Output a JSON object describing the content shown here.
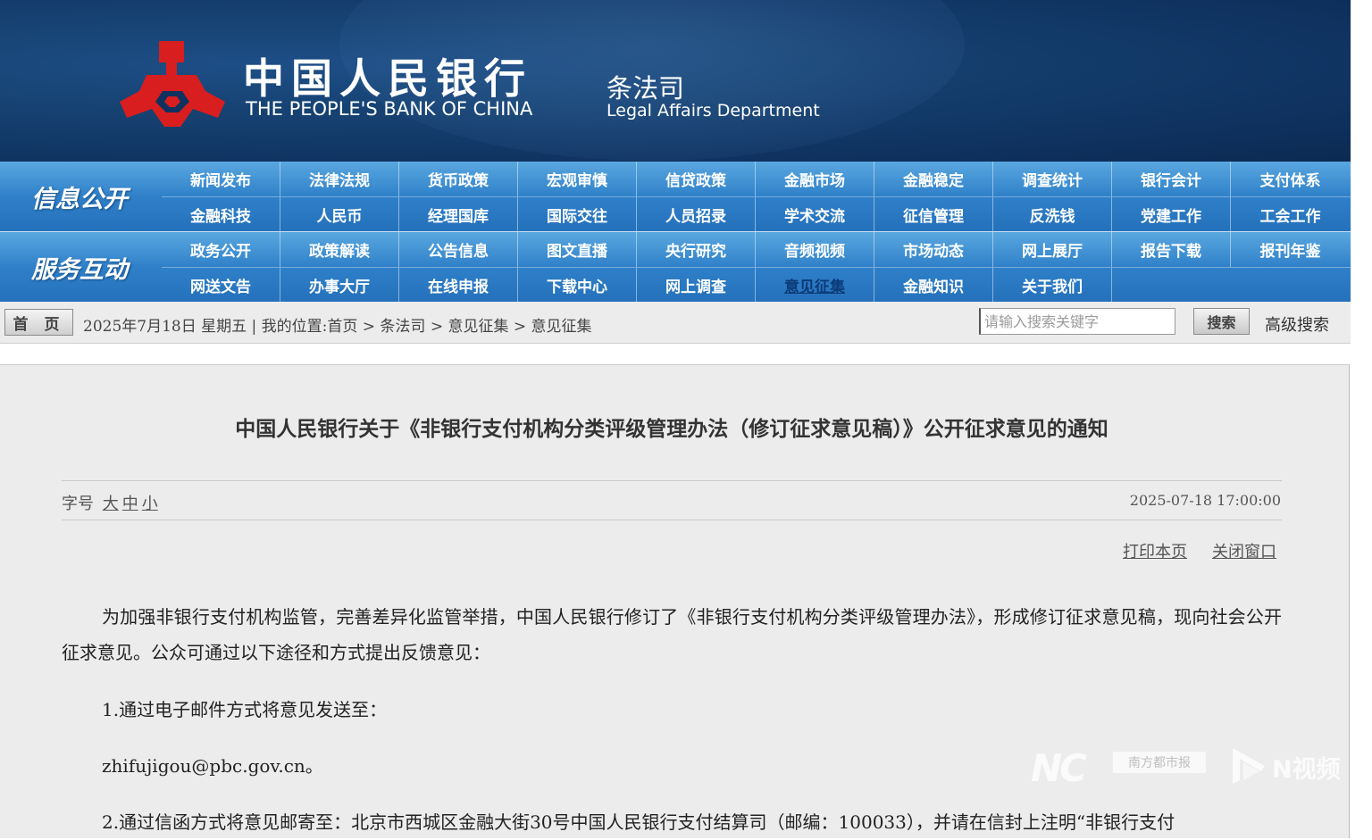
{
  "header": {
    "bank_name_cn": "中国人民银行",
    "bank_name_en": "THE PEOPLE'S BANK OF CHINA",
    "dept_name_cn": "条法司",
    "dept_name_en": "Legal Affairs Department"
  },
  "nav": {
    "info_label": "信息公开",
    "service_label": "服务互动",
    "info_row1": [
      "新闻发布",
      "法律法规",
      "货币政策",
      "宏观审慎",
      "信贷政策",
      "金融市场",
      "金融稳定",
      "调查统计",
      "银行会计",
      "支付体系"
    ],
    "info_row2": [
      "金融科技",
      "人民币",
      "经理国库",
      "国际交往",
      "人员招录",
      "学术交流",
      "征信管理",
      "反洗钱",
      "党建工作",
      "工会工作"
    ],
    "service_row1": [
      "政务公开",
      "政策解读",
      "公告信息",
      "图文直播",
      "央行研究",
      "音频视频",
      "市场动态",
      "网上展厅",
      "报告下载",
      "报刊年鉴"
    ],
    "service_row2": [
      "网送文告",
      "办事大厅",
      "在线申报",
      "下载中心",
      "网上调查",
      "意见征集",
      "金融知识",
      "关于我们",
      "",
      ""
    ],
    "active_item": "意见征集"
  },
  "breadcrumb": {
    "home_label": "首 页",
    "text": "2025年7月18日 星期五 | 我的位置:首页 > 条法司 > 意见征集 > 意见征集"
  },
  "search": {
    "placeholder": "请输入搜索关键字",
    "button_label": "搜索",
    "advanced_label": "高级搜索"
  },
  "article": {
    "title": "中国人民银行关于《非银行支付机构分类评级管理办法（修订征求意见稿）》公开征求意见的通知",
    "font_size_label": "字号",
    "font_large": "大",
    "font_medium": "中",
    "font_small": "小",
    "date": "2025-07-18 17:00:00",
    "print_label": "打印本页",
    "close_label": "关闭窗口",
    "para1": "为加强非银行支付机构监管，完善差异化监管举措，中国人民银行修订了《非银行支付机构分类评级管理办法》，形成修订征求意见稿，现向社会公开征求意见。公众可通过以下途径和方式提出反馈意见：",
    "para2": "1.通过电子邮件方式将意见发送至：",
    "para3": "zhifujigou@pbc.gov.cn。",
    "para4": "2.通过信函方式将意见邮寄至：北京市西城区金融大街30号中国人民银行支付结算司（邮编：100033），并请在信封上注明“非银行支付"
  },
  "watermark": {
    "logo_text": "NC",
    "paper_text": "南方都市报",
    "video_text": "N视频"
  },
  "colors": {
    "header_bg": "#0f3260",
    "nav_bg": "#2f80c9",
    "logo_red": "#d81e1e",
    "content_bg": "#ececec"
  }
}
